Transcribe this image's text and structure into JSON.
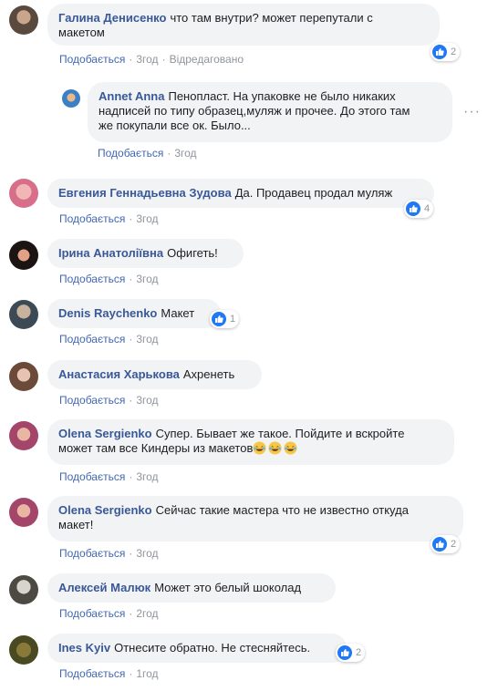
{
  "actions": {
    "like": "Подобається",
    "edited": "Відредаговано",
    "dot": "·"
  },
  "comments": [
    {
      "name": "Галина Денисенко",
      "text_line1": "что там внутри? может перепутали с",
      "text_line2": "макетом",
      "time": "3год",
      "reactions": "2"
    },
    {
      "name": "Annet Anna",
      "text_line1": "Пенопласт. На упаковке не было никаких",
      "text_line2": "надписей по типу образец,муляж и прочее. До этого там",
      "text_line3": "же покупали все ок. Было...",
      "time": "3год"
    },
    {
      "name": "Евгения Геннадьевна Зудова",
      "text": "Да. Продавец продал муляж",
      "time": "3год",
      "reactions": "4"
    },
    {
      "name": "Ірина Анатоліївна",
      "text": "Офигеть!",
      "time": "3год"
    },
    {
      "name": "Denis Raychenko",
      "text": "Макет",
      "time": "3год",
      "reactions": "1"
    },
    {
      "name": "Анастасия Харькова",
      "text": "Ахренеть",
      "time": "3год"
    },
    {
      "name": "Olena Sergienko",
      "text_line1": "Супер. Бывает же такое. Пойдите и вскройте",
      "text_line2": "может там все Киндеры из макетов",
      "emoji": "laughing-tears",
      "time": "3год"
    },
    {
      "name": "Olena Sergienko",
      "text_line1": "Сейчас такие мастера что не известно откуда",
      "text_line2": "макет!",
      "time": "3год",
      "reactions": "2"
    },
    {
      "name": "Алексей Малюк",
      "text": "Может это белый шоколад",
      "time": "2год"
    },
    {
      "name": "Ines Kyiv",
      "text": "Отнесите обратно. Не стесняйтесь.",
      "time": "1год",
      "reactions": "2"
    }
  ],
  "colors": {
    "name": "#385898",
    "link": "#4267b2",
    "meta": "#90949c",
    "bubble": "#f2f3f5",
    "like": "#2078f4"
  }
}
